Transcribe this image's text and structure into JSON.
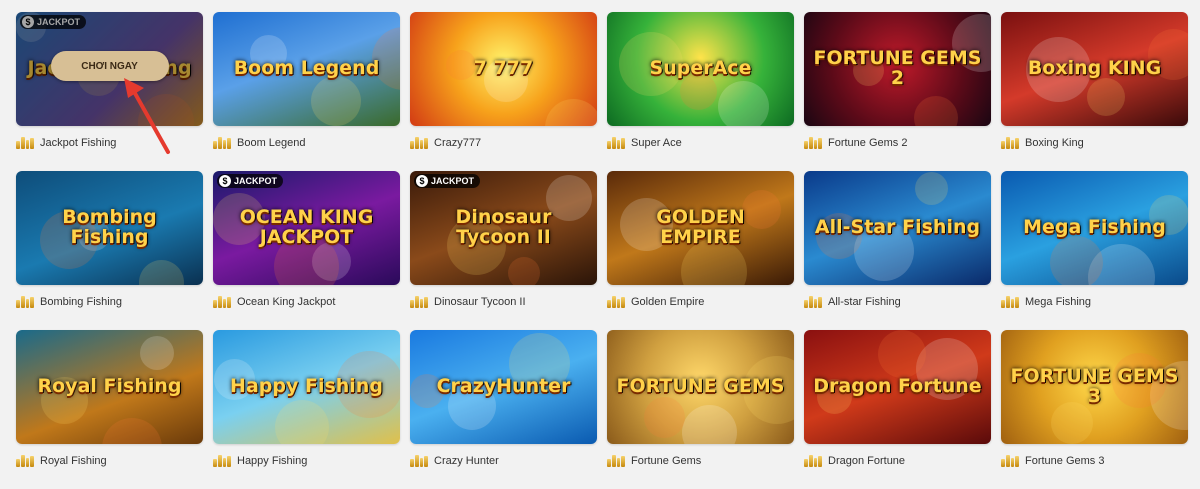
{
  "play_button_label": "CHƠI NGAY",
  "jackpot_badge": "JACKPOT",
  "colors": {
    "play_button": "#d7bf95",
    "arrow": "#e53a2e"
  },
  "games": [
    {
      "name": "Jackpot Fishing",
      "art": "Jackpot Fishing",
      "bg": "linear-gradient(135deg,#2a6fb5,#6a4fa0 60%,#c98a2a)",
      "jackpot": true,
      "hovered": true
    },
    {
      "name": "Boom Legend",
      "art": "Boom Legend",
      "bg": "linear-gradient(160deg,#1f6fd1,#5aa0e8 45%,#3a6a2a)",
      "jackpot": false
    },
    {
      "name": "Crazy777",
      "art": "7 777",
      "bg": "radial-gradient(circle at 50% 45%,#fff36b,#f7a21b 45%,#d23a14)",
      "jackpot": false
    },
    {
      "name": "Super Ace",
      "art": "SuperAce",
      "bg": "radial-gradient(circle at 50% 40%,#ffe34a,#36b23a 55%,#0d6a22)",
      "jackpot": false
    },
    {
      "name": "Fortune Gems 2",
      "art": "FORTUNE GEMS 2",
      "bg": "radial-gradient(circle at 50% 45%,#c01a2a,#5a0a18 60%,#1a0612)",
      "jackpot": false
    },
    {
      "name": "Boxing King",
      "art": "Boxing KING",
      "bg": "linear-gradient(160deg,#7a1010,#d43a2a 50%,#3a0a0a)",
      "jackpot": false
    },
    {
      "name": "Bombing Fishing",
      "art": "Bombing Fishing",
      "bg": "linear-gradient(160deg,#0e4d7a,#1a7ab0 55%,#0a3050)",
      "jackpot": false
    },
    {
      "name": "Ocean King Jackpot",
      "art": "OCEAN KING JACKPOT",
      "bg": "linear-gradient(160deg,#1a1a6a,#7a1aa0 50%,#2a0a5a)",
      "jackpot": true
    },
    {
      "name": "Dinosaur Tycoon II",
      "art": "Dinosaur Tycoon II",
      "bg": "linear-gradient(160deg,#3a1a0a,#8a4a1a 50%,#2a1408)",
      "jackpot": true
    },
    {
      "name": "Golden Empire",
      "art": "GOLDEN EMPIRE",
      "bg": "linear-gradient(160deg,#5a2a0a,#c0781a 50%,#3a1a06)",
      "jackpot": false
    },
    {
      "name": "All-star Fishing",
      "art": "All-Star Fishing",
      "bg": "linear-gradient(160deg,#0a3a8a,#2a8ad0 50%,#0a2a6a)",
      "jackpot": false
    },
    {
      "name": "Mega Fishing",
      "art": "Mega Fishing",
      "bg": "linear-gradient(160deg,#0a5ab0,#2aa0e0 50%,#0a4a8a)",
      "jackpot": false
    },
    {
      "name": "Royal Fishing",
      "art": "Royal Fishing",
      "bg": "linear-gradient(160deg,#1a6a8a,#c0781a 60%,#6a3a0a)",
      "jackpot": false
    },
    {
      "name": "Happy Fishing",
      "art": "Happy Fishing",
      "bg": "linear-gradient(160deg,#2a9ae0,#7ad0f0 50%,#e0c04a)",
      "jackpot": false
    },
    {
      "name": "Crazy Hunter",
      "art": "CrazyHunter",
      "bg": "linear-gradient(160deg,#1a7ae0,#4ab0f0 50%,#0a5ab0)",
      "jackpot": false
    },
    {
      "name": "Fortune Gems",
      "art": "FORTUNE GEMS",
      "bg": "radial-gradient(circle at 50% 45%,#ffd86a,#d0a040 50%,#8a5a1a)",
      "jackpot": false
    },
    {
      "name": "Dragon Fortune",
      "art": "Dragon Fortune",
      "bg": "linear-gradient(160deg,#8a1010,#d03a1a 50%,#5a0a0a)",
      "jackpot": false
    },
    {
      "name": "Fortune Gems 3",
      "art": "FORTUNE GEMS 3",
      "bg": "radial-gradient(circle at 50% 45%,#ffd84a,#e0a020 50%,#a06010)",
      "jackpot": false
    }
  ]
}
